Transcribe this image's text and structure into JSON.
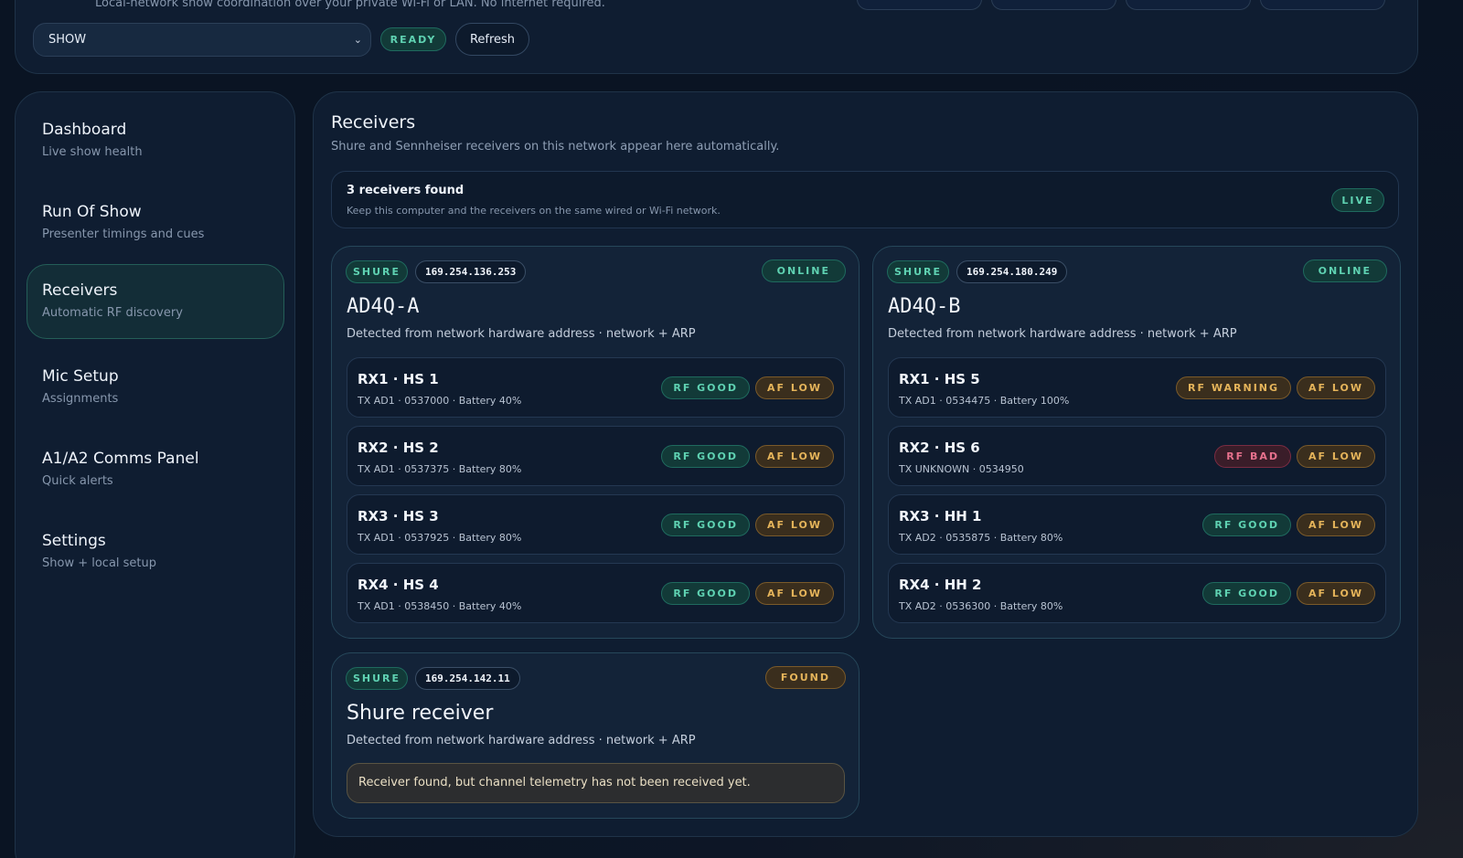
{
  "header": {
    "subtitle": "Local-network show coordination over your private Wi-Fi or LAN. No internet required.",
    "show_select": "SHOW",
    "status": "READY",
    "refresh_label": "Refresh"
  },
  "sidebar": {
    "items": [
      {
        "title": "Dashboard",
        "subtitle": "Live show health"
      },
      {
        "title": "Run Of Show",
        "subtitle": "Presenter timings and cues"
      },
      {
        "title": "Receivers",
        "subtitle": "Automatic RF discovery"
      },
      {
        "title": "Mic Setup",
        "subtitle": "Assignments"
      },
      {
        "title": "A1/A2 Comms Panel",
        "subtitle": "Quick alerts"
      },
      {
        "title": "Settings",
        "subtitle": "Show + local setup"
      }
    ]
  },
  "main": {
    "title": "Receivers",
    "subtitle": "Shure and Sennheiser receivers on this network appear here automatically.",
    "banner": {
      "title": "3 receivers found",
      "subtitle": "Keep this computer and the receivers on the same wired or Wi-Fi network.",
      "badge": "LIVE"
    },
    "receivers": [
      {
        "brand": "SHURE",
        "ip": "169.254.136.253",
        "status": "ONLINE",
        "name": "AD4Q-A",
        "detail": "Detected from network hardware address · network + ARP",
        "channels": [
          {
            "name": "RX1 · HS 1",
            "detail": "TX AD1 · 0537000 · Battery 40%",
            "rf": "RF GOOD",
            "af": "AF LOW"
          },
          {
            "name": "RX2 · HS 2",
            "detail": "TX AD1 · 0537375 · Battery 80%",
            "rf": "RF GOOD",
            "af": "AF LOW"
          },
          {
            "name": "RX3 · HS 3",
            "detail": "TX AD1 · 0537925 · Battery 80%",
            "rf": "RF GOOD",
            "af": "AF LOW"
          },
          {
            "name": "RX4 · HS 4",
            "detail": "TX AD1 · 0538450 · Battery 40%",
            "rf": "RF GOOD",
            "af": "AF LOW"
          }
        ]
      },
      {
        "brand": "SHURE",
        "ip": "169.254.180.249",
        "status": "ONLINE",
        "name": "AD4Q-B",
        "detail": "Detected from network hardware address · network + ARP",
        "channels": [
          {
            "name": "RX1 · HS 5",
            "detail": "TX AD1 · 0534475 · Battery 100%",
            "rf": "RF WARNING",
            "af": "AF LOW"
          },
          {
            "name": "RX2 · HS 6",
            "detail": "TX UNKNOWN · 0534950",
            "rf": "RF BAD",
            "af": "AF LOW"
          },
          {
            "name": "RX3 · HH 1",
            "detail": "TX AD2 · 0535875 · Battery 80%",
            "rf": "RF GOOD",
            "af": "AF LOW"
          },
          {
            "name": "RX4 · HH 2",
            "detail": "TX AD2 · 0536300 · Battery 80%",
            "rf": "RF GOOD",
            "af": "AF LOW"
          }
        ]
      },
      {
        "brand": "SHURE",
        "ip": "169.254.142.11",
        "status": "FOUND",
        "name": "Shure receiver",
        "detail": "Detected from network hardware address · network + ARP",
        "note": "Receiver found, but channel telemetry has not been received yet."
      }
    ]
  },
  "colors": {
    "accent_good": "#5fd2b2",
    "accent_warn": "#e5b45a",
    "accent_bad": "#e7718d",
    "background": "#0a1423"
  }
}
